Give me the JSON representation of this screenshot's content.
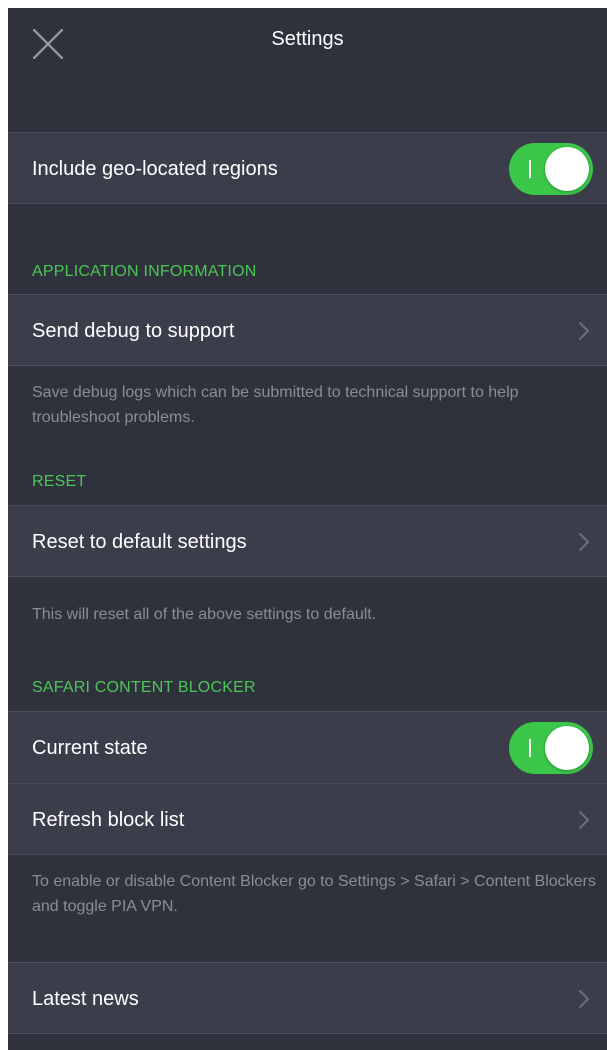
{
  "header": {
    "title": "Settings",
    "close_icon": "close-icon"
  },
  "geo_row": {
    "label": "Include geo-located regions",
    "toggle_on": true
  },
  "application_information": {
    "title": "APPLICATION INFORMATION",
    "send_debug_label": "Send debug to support",
    "description": "Save debug logs which can be submitted to technical support to help troubleshoot problems."
  },
  "reset": {
    "title": "RESET",
    "reset_label": "Reset to default settings",
    "description": "This will reset all of the above settings to default."
  },
  "safari_content_blocker": {
    "title": "SAFARI CONTENT BLOCKER",
    "current_state_label": "Current state",
    "current_state_on": true,
    "refresh_label": "Refresh block list",
    "description": "To enable or disable Content Blocker go to Settings > Safari > Content Blockers and toggle PIA VPN."
  },
  "latest_news": {
    "label": "Latest news"
  },
  "colors": {
    "background": "#2f323d",
    "row_background": "#3b3e4a",
    "accent_green": "#3bc74a",
    "section_title": "#4cc655",
    "footnote_text": "#8a8d98"
  }
}
